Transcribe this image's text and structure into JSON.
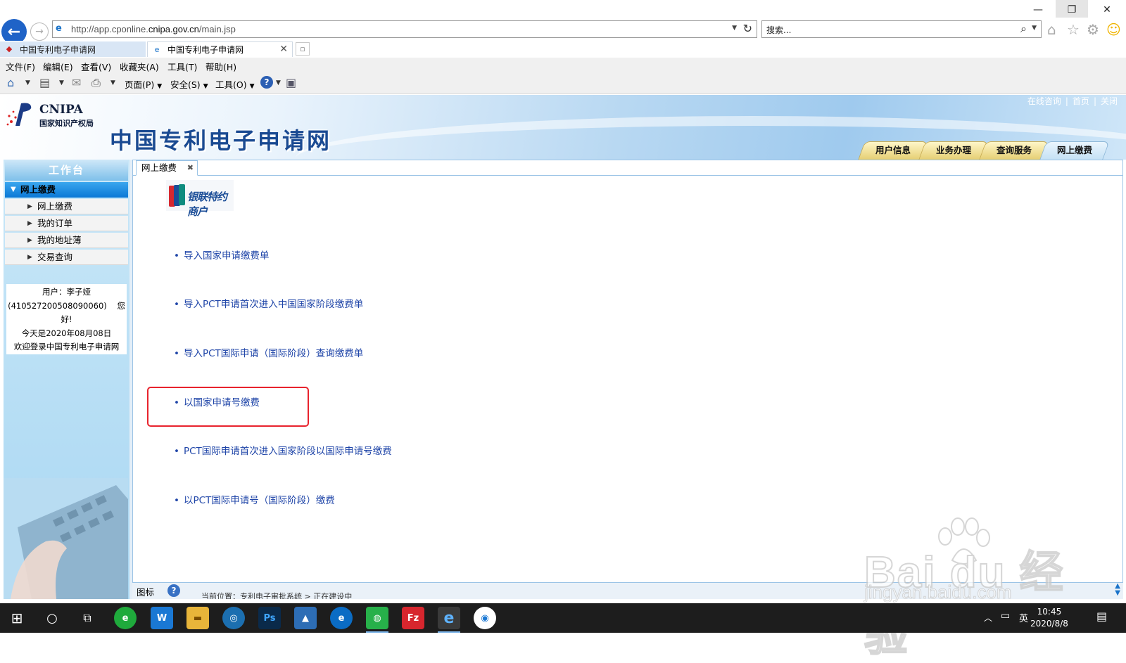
{
  "browser": {
    "url_prefix": "http://app.cponline.",
    "url_domain": "cnipa.gov.cn",
    "url_path": "/main.jsp",
    "search_placeholder": "搜索...",
    "tabs": [
      {
        "label": "中国专利电子申请网"
      },
      {
        "label": "中国专利电子申请网"
      }
    ],
    "menu": [
      "文件(F)",
      "编辑(E)",
      "查看(V)",
      "收藏夹(A)",
      "工具(T)",
      "帮助(H)"
    ],
    "commands": {
      "page": "页面(P)",
      "safety": "安全(S)",
      "tools": "工具(O)"
    },
    "window_buttons": {
      "minimize": "—",
      "restore": "❐",
      "close": "✕"
    }
  },
  "header": {
    "logo_en": "CNIPA",
    "logo_cn": "国家知识产权局",
    "site_title": "中国专利电子申请网",
    "top_links": [
      "在线咨询",
      "首页",
      "关闭"
    ],
    "nav_tabs": [
      "用户信息",
      "业务办理",
      "查询服务",
      "网上缴费"
    ]
  },
  "sidebar": {
    "workspace_title": "工作台",
    "section_title": "网上缴费",
    "items": [
      "网上缴费",
      "我的订单",
      "我的地址薄",
      "交易查询"
    ],
    "user": {
      "line1": "用户：李子娅",
      "line2": "(410527200508090060)",
      "line2b": "您",
      "line3": "好!",
      "line4": "今天是2020年08月08日",
      "line5": "欢迎登录中国专利电子申请网"
    }
  },
  "content": {
    "tab_label": "网上缴费",
    "unionpay_text": "银联特约商户",
    "bullet": "•",
    "links": [
      "导入国家申请缴费单",
      "导入PCT申请首次进入中国国家阶段缴费单",
      "导入PCT国际申请（国际阶段）查询缴费单",
      "以国家申请号缴费",
      "PCT国际申请首次进入国家阶段以国际申请号缴费",
      "以PCT国际申请号（国际阶段）缴费"
    ],
    "status_label": "图标",
    "status_location": "当前位置：专利电子审批系统 > 正在建设中"
  },
  "watermark": {
    "text": "Bai du 经验",
    "url": "jingyan.baidu.com"
  },
  "taskbar": {
    "time": "10:45",
    "date": "2020/8/8",
    "ime": "英"
  },
  "colors": {
    "accent": "#1f45a8",
    "highlight": "#e8232d",
    "nav_tab": "#e6cf73"
  }
}
